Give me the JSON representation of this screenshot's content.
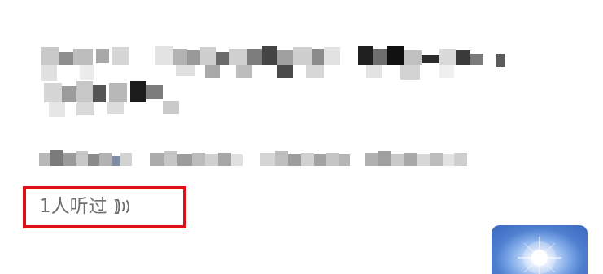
{
  "blurred_title": "",
  "blurred_subtitle": "",
  "listen": {
    "count_text": "1人听过"
  },
  "icons": {
    "listen_icon": "sound-wave-icon",
    "thumbnail": "sun-glare-thumbnail"
  },
  "colors": {
    "highlight_border": "#e0101a",
    "meta_text": "#6f6f6f"
  }
}
